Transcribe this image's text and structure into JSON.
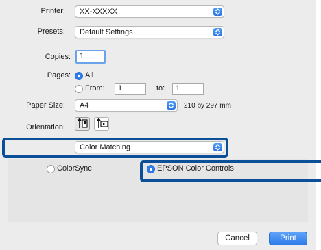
{
  "printer": {
    "label": "Printer:",
    "value": "XX-XXXXX"
  },
  "presets": {
    "label": "Presets:",
    "value": "Default Settings"
  },
  "copies": {
    "label": "Copies:",
    "value": "1"
  },
  "pages": {
    "label": "Pages:",
    "all_label": "All",
    "from_label": "From:",
    "from_value": "1",
    "to_label": "to:",
    "to_value": "1"
  },
  "paper_size": {
    "label": "Paper Size:",
    "value": "A4",
    "dimensions": "210 by 297 mm"
  },
  "orientation": {
    "label": "Orientation:"
  },
  "panel_menu": {
    "value": "Color Matching"
  },
  "color_matching": {
    "options": [
      "ColorSync",
      "EPSON Color Controls"
    ],
    "selected": "EPSON Color Controls"
  },
  "buttons": {
    "cancel": "Cancel",
    "print": "Print"
  },
  "colors": {
    "accent": "#2f7de9",
    "highlight": "#0b4f98",
    "dialog_bg": "#ececec"
  }
}
